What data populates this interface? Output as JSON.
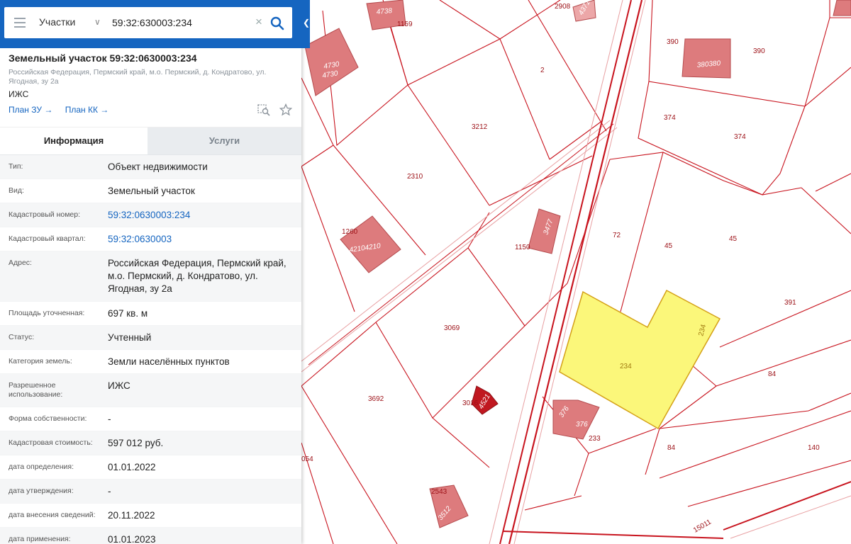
{
  "search": {
    "layer": "Участки",
    "query": "59:32:630003:234"
  },
  "object": {
    "title": "Земельный участок 59:32:0630003:234",
    "address": "Российская Федерация, Пермский край, м.о. Пермский, д. Кондратово, ул. Ягодная, зу 2а",
    "use_short": "ИЖС",
    "link_plan_zu": "План ЗУ →",
    "link_plan_kk": "План КК →"
  },
  "tabs": {
    "info": "Информация",
    "services": "Услуги"
  },
  "properties": [
    {
      "key": "Тип:",
      "value": "Объект недвижимости"
    },
    {
      "key": "Вид:",
      "value": "Земельный участок"
    },
    {
      "key": "Кадастровый номер:",
      "value": "59:32:0630003:234",
      "link": true
    },
    {
      "key": "Кадастровый квартал:",
      "value": "59:32:0630003",
      "link": true
    },
    {
      "key": "Адрес:",
      "value": "Российская Федерация, Пермский край, м.о. Пермский, д. Кондратово, ул. Ягодная, зу 2а"
    },
    {
      "key": "Площадь уточненная:",
      "value": "697 кв. м"
    },
    {
      "key": "Статус:",
      "value": "Учтенный"
    },
    {
      "key": "Категория земель:",
      "value": "Земли населённых пунктов"
    },
    {
      "key": "Разрешенное использование:",
      "value": "ИЖС"
    },
    {
      "key": "Форма собственности:",
      "value": "-"
    },
    {
      "key": "Кадастровая стоимость:",
      "value": "597 012 руб."
    },
    {
      "key": "дата определения:",
      "value": "01.01.2022"
    },
    {
      "key": "дата утверждения:",
      "value": "-"
    },
    {
      "key": "дата внесения сведений:",
      "value": "20.11.2022"
    },
    {
      "key": "дата применения:",
      "value": "01.01.2023"
    }
  ],
  "map": {
    "parcel_labels": [
      "1159",
      "2",
      "390",
      "390",
      "380380",
      "374",
      "374",
      "3212",
      "2310",
      "1260",
      "4210",
      "4210",
      "1150",
      "72",
      "45",
      "45",
      "391",
      "3069",
      "234",
      "234",
      "84",
      "3692",
      "3016",
      "233",
      "84",
      "140",
      "054",
      "2543",
      "15011",
      "2908",
      "4738",
      "4730",
      "4730",
      "3477",
      "4521",
      "376",
      "376",
      "3512",
      "4371"
    ],
    "colors": {
      "parcel_line": "#c8141e",
      "building": "#dd7b7d",
      "selected": "#fbf77a",
      "selected_stroke": "#d4a017"
    }
  }
}
